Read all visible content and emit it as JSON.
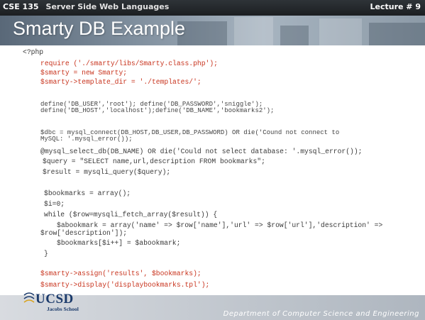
{
  "header": {
    "course_number": "CSE 135",
    "course_name": "Server Side Web Languages",
    "lecture": "Lecture # 9"
  },
  "slide": {
    "title": "Smarty DB Example"
  },
  "code": {
    "line01": "<?php",
    "line02": "require ('./smarty/libs/Smarty.class.php');",
    "line03": "$smarty = new Smarty;",
    "line04": "$smarty->template_dir = './templates/';",
    "line05": "define('DB_USER','root'); define('DB_PASSWORD','sniggle');",
    "line06": "define('DB_HOST','localhost');define('DB_NAME','bookmarks2');",
    "line07": "$dbc = mysql_connect(DB_HOST,DB_USER,DB_PASSWORD) OR die('Cound not connect to",
    "line08": "MySQL: '.mysql_error());",
    "line09": "@mysql_select_db(DB_NAME) OR die('Could not select database: '.mysql_error());",
    "line10": "$query = \"SELECT name,url,description FROM bookmarks\";",
    "line11": "$result = mysqli_query($query);",
    "line12": "$bookmarks = array();",
    "line13": "$i=0;",
    "line14": "while ($row=mysqli_fetch_array($result)) {",
    "line15": "$abookmark = array('name' => $row['name'],'url' => $row['url'],'description' =>",
    "line16": "$row['description']);",
    "line17": "$bookmarks[$i++] = $abookmark;",
    "line18": "}",
    "line19": "$smarty->assign('results', $bookmarks);",
    "line20": "$smarty->display('displaybookmarks.tpl');"
  },
  "footer": {
    "logo_text": "UCSD",
    "logo_subtext": "Jacobs School",
    "department": "Department of Computer Science and Engineering"
  },
  "colors": {
    "code_highlight": "#c8331d",
    "code_text": "#3a3a3a",
    "header_bar": "#1c1f22",
    "logo_blue": "#1b3a6b"
  }
}
